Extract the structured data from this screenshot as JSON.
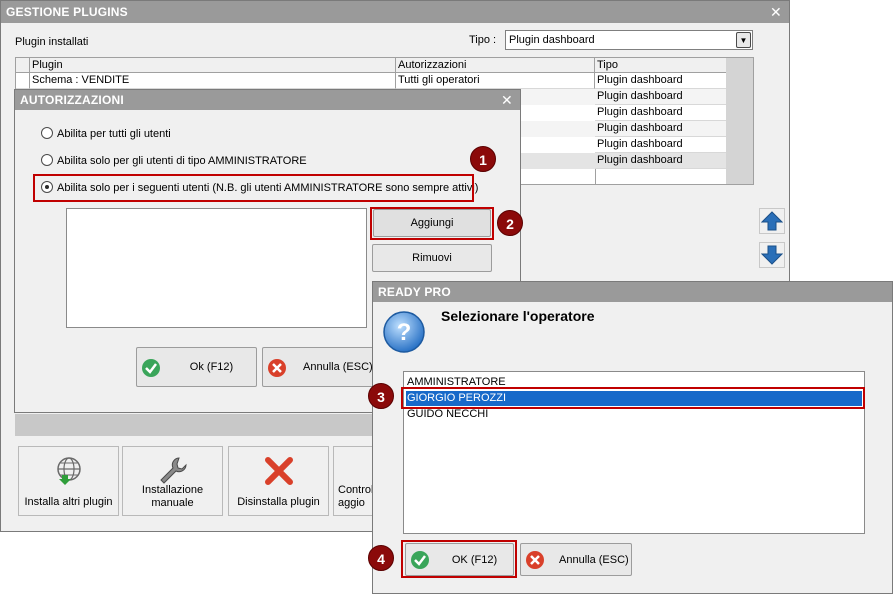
{
  "main": {
    "title": "GESTIONE PLUGINS",
    "installed_label": "Plugin installati",
    "tipo_label": "Tipo :",
    "tipo_value": "Plugin dashboard",
    "columns": [
      "Plugin",
      "Autorizzazioni",
      "Tipo"
    ],
    "rows": [
      {
        "plugin": "Schema : VENDITE",
        "auth": "Tutti gli operatori",
        "tipo": "Plugin dashboard"
      },
      {
        "plugin": "",
        "auth": "",
        "tipo": "Plugin dashboard"
      },
      {
        "plugin": "",
        "auth": "",
        "tipo": "Plugin dashboard"
      },
      {
        "plugin": "",
        "auth": "",
        "tipo": "Plugin dashboard"
      },
      {
        "plugin": "",
        "auth": "",
        "tipo": "Plugin dashboard"
      },
      {
        "plugin": "",
        "auth": "",
        "tipo": "Plugin dashboard"
      }
    ],
    "tools": [
      {
        "label": "Installa altri plugin"
      },
      {
        "label": "Installazione manuale"
      },
      {
        "label": "Disinstalla plugin"
      },
      {
        "label": "Controlla aggio"
      }
    ]
  },
  "auth": {
    "title": "AUTORIZZAZIONI",
    "options": [
      "Abilita per tutti gli utenti",
      "Abilita solo per gli utenti di tipo AMMINISTRATORE",
      "Abilita solo per i seguenti utenti (N.B. gli utenti AMMINISTRATORE sono sempre attivi)"
    ],
    "selected_option": 2,
    "add_label": "Aggiungi",
    "remove_label": "Rimuovi",
    "ok_label": "Ok (F12)",
    "cancel_label": "Annulla (ESC)"
  },
  "ready": {
    "title": "READY PRO",
    "prompt": "Selezionare l'operatore",
    "operators": [
      "AMMINISTRATORE",
      "GIORGIO PEROZZI",
      "GUIDO NECCHI"
    ],
    "selected_operator": 1,
    "ok_label": "OK (F12)",
    "cancel_label": "Annulla (ESC)"
  },
  "steps": [
    "1",
    "2",
    "3",
    "4"
  ],
  "colors": {
    "highlight": "#c00000",
    "badge": "#8b0a0a",
    "selection": "#1769c9",
    "titlebar": "#9a9a9a"
  }
}
